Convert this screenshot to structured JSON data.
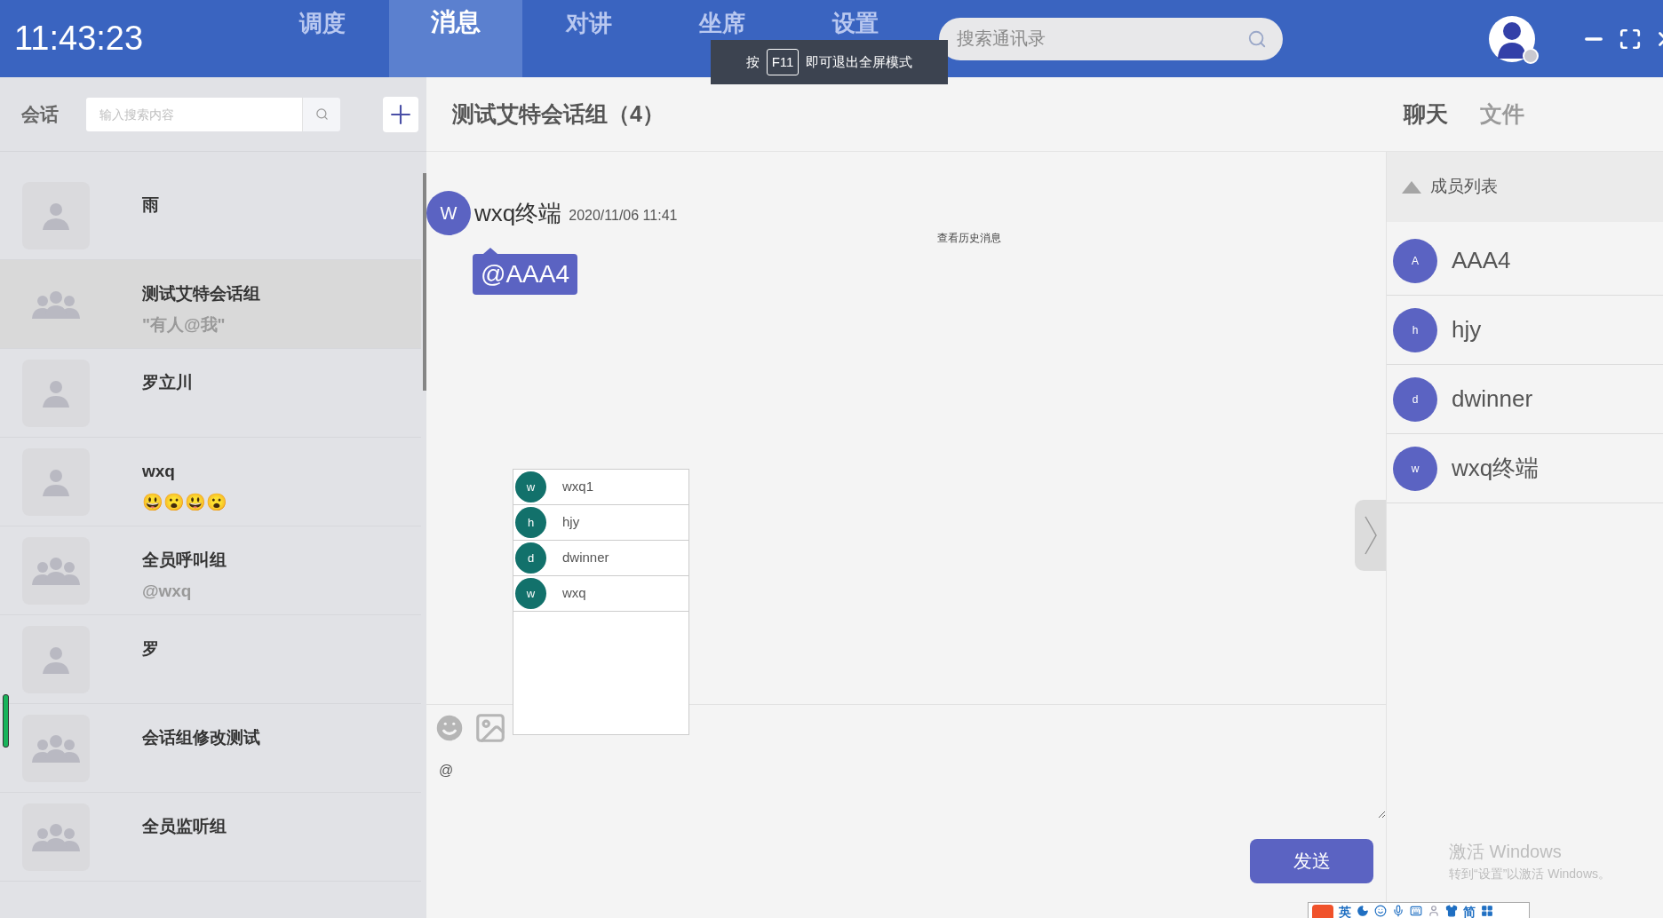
{
  "top_bar": {
    "clock": "11:43:23",
    "tabs": [
      {
        "label": "调度",
        "selected": false
      },
      {
        "label": "消息",
        "selected": true
      },
      {
        "label": "对讲",
        "selected": false
      },
      {
        "label": "坐席",
        "selected": false
      },
      {
        "label": "设置",
        "selected": false
      }
    ],
    "search": {
      "placeholder": "搜索通讯录"
    }
  },
  "fullscreen_hint": {
    "prefix": "按",
    "key": "F11",
    "suffix": "即可退出全屏模式"
  },
  "sidebar": {
    "title": "会话",
    "search": {
      "placeholder": "输入搜索内容"
    },
    "items": [
      {
        "kind": "single",
        "name": "雨",
        "selected": false
      },
      {
        "kind": "group",
        "name": "测试艾特会话组",
        "subtitle": "\"有人@我\"",
        "selected": true
      },
      {
        "kind": "single",
        "name": "罗立川",
        "selected": false
      },
      {
        "kind": "single",
        "name": "wxq",
        "subtitle": "😃😮😃😮",
        "selected": false
      },
      {
        "kind": "group",
        "name": "全员呼叫组",
        "subtitle": "@wxq",
        "selected": false
      },
      {
        "kind": "single",
        "name": "罗",
        "selected": false
      },
      {
        "kind": "group",
        "name": "会话组修改测试",
        "selected": false
      },
      {
        "kind": "group",
        "name": "全员监听组",
        "selected": false
      }
    ]
  },
  "chat": {
    "title": "测试艾特会话组（4）",
    "tabs": [
      {
        "label": "聊天",
        "selected": true
      },
      {
        "label": "文件",
        "selected": false
      }
    ],
    "history_link": "查看历史消息",
    "messages": [
      {
        "avatar": "W",
        "sender": "wxq终端",
        "time": "2020/11/06 11:41",
        "text": "@AAA4"
      }
    ],
    "mention_popup": [
      {
        "initial": "w",
        "name": "wxq1"
      },
      {
        "initial": "h",
        "name": "hjy"
      },
      {
        "initial": "d",
        "name": "dwinner"
      },
      {
        "initial": "w",
        "name": "wxq"
      }
    ],
    "composer": {
      "value": "@"
    },
    "send_button": "发送"
  },
  "members": {
    "title": "成员列表",
    "expanded": true,
    "items": [
      {
        "initial": "A",
        "name": "AAA4"
      },
      {
        "initial": "h",
        "name": "hjy"
      },
      {
        "initial": "d",
        "name": "dwinner"
      },
      {
        "initial": "w",
        "name": "wxq终端"
      }
    ]
  },
  "activation_notice": {
    "title": "激活 Windows",
    "subtitle": "转到“设置”以激活 Windows。"
  },
  "ime_bar": {
    "mode": "英",
    "script": "简"
  }
}
